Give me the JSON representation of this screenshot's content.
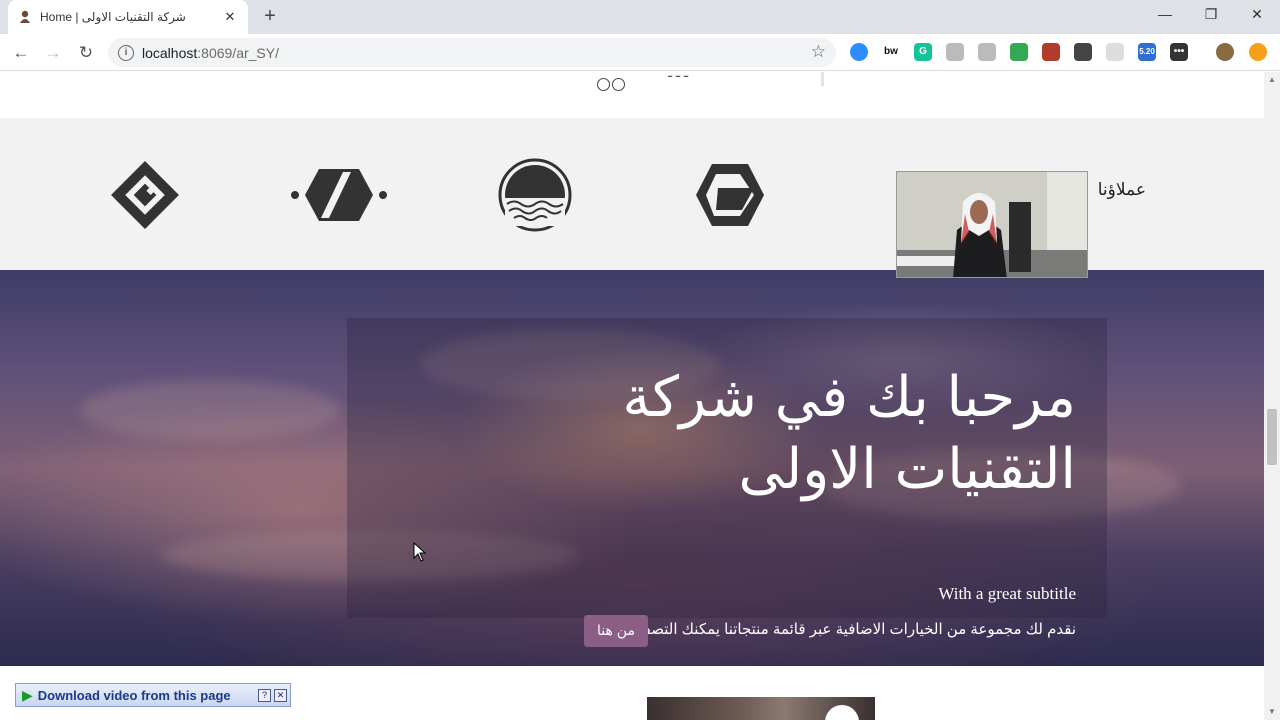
{
  "browser": {
    "tab_title": "Home | شركة التقنيات الاولى",
    "tab_close": "✕",
    "new_tab": "+",
    "url_host": "localhost",
    "url_rest": ":8069/ar_SY/",
    "back": "←",
    "forward": "→",
    "reload": "↻",
    "star": "☆",
    "minimize": "—",
    "restore": "❐",
    "close": "✕",
    "extensions": [
      {
        "name": "zoom-extension-icon",
        "label": "",
        "color": "#2d8cff"
      },
      {
        "name": "bw-extension-icon",
        "label": "bw",
        "color": "#ffffff"
      },
      {
        "name": "grammarly-extension-icon",
        "label": "G",
        "color": "#15c39a"
      },
      {
        "name": "pin-extension-icon",
        "label": "",
        "color": "#bbbbbb"
      },
      {
        "name": "drive-extension-icon",
        "label": "",
        "color": "#bbbbbb"
      },
      {
        "name": "chrome-color-extension-icon",
        "label": "",
        "color": "#34a853"
      },
      {
        "name": "pdf-extension-icon",
        "label": "",
        "color": "#b33b2e"
      },
      {
        "name": "shield-extension-icon",
        "label": "",
        "color": "#444444"
      },
      {
        "name": "blank-extension-icon",
        "label": "",
        "color": "#dddddd"
      },
      {
        "name": "speed-extension-icon",
        "label": "5.20",
        "color": "#2f6fcf"
      },
      {
        "name": "more-extension-icon",
        "label": "•••",
        "color": "#333333"
      },
      {
        "name": "profile-avatar",
        "label": "",
        "color": "#8a6a40"
      },
      {
        "name": "update-extension-icon",
        "label": "",
        "color": "#f6a01a"
      }
    ]
  },
  "page": {
    "clients_heading": "عملاؤنا",
    "hero": {
      "title": "مرحبا بك في شركة التقنيات الاولى",
      "subtitle": "With a great subtitle",
      "description": "نقدم لك مجموعة من الخيارات الاضافية عبر قائمة منتجاتنا يمكنك التصفح",
      "button": "من هنا"
    }
  },
  "download_bar": {
    "label": "Download video from this page",
    "help": "?",
    "close": "✕"
  }
}
